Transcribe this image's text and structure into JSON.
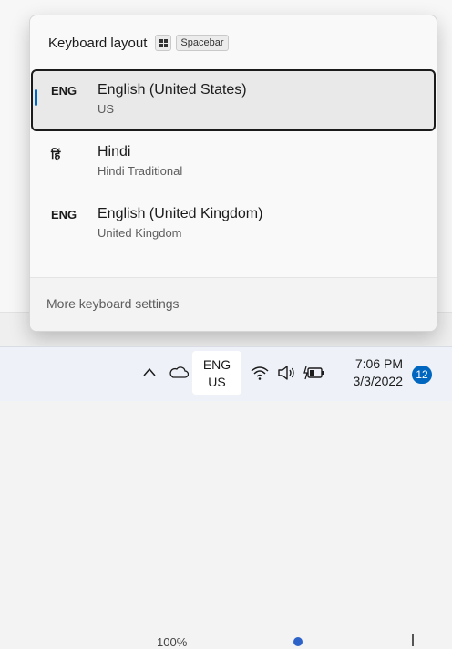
{
  "background": {
    "zoom_text": "100%"
  },
  "flyout": {
    "title": "Keyboard layout",
    "shortcut_icon": "windows-key-icon",
    "shortcut_key": "Spacebar",
    "languages": [
      {
        "code": "ENG",
        "name": "English (United States)",
        "sub": "US",
        "selected": true
      },
      {
        "code": "हिं",
        "name": "Hindi",
        "sub": "Hindi Traditional",
        "selected": false
      },
      {
        "code": "ENG",
        "name": "English (United Kingdom)",
        "sub": "United Kingdom",
        "selected": false
      }
    ],
    "footer_link": "More keyboard settings"
  },
  "taskbar": {
    "icons": [
      "chevron-up-icon",
      "onedrive-cloud-icon",
      "wifi-icon",
      "volume-icon",
      "battery-charging-icon"
    ],
    "ime_top": "ENG",
    "ime_bottom": "US",
    "time": "7:06 PM",
    "date": "3/3/2022",
    "notification_count": "12"
  },
  "colors": {
    "accent": "#0067c0",
    "selected_border": "#1b1b1b",
    "flyout_bg": "#f9f9f9",
    "taskbar_bg": "#eef2f8"
  }
}
